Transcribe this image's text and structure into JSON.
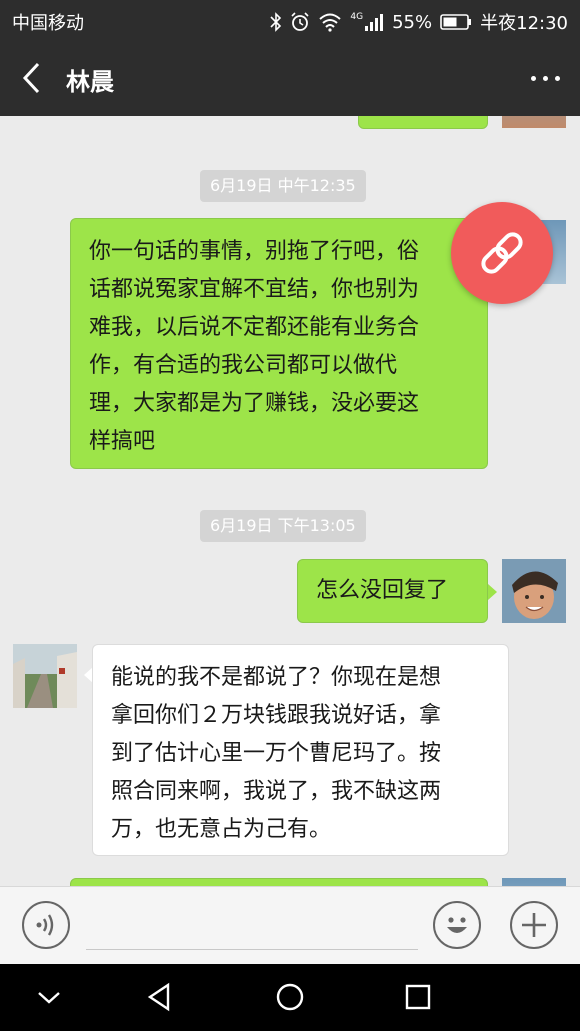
{
  "status_bar": {
    "carrier": "中国移动",
    "network": "4G",
    "battery": "55%",
    "time": "半夜12:30"
  },
  "header": {
    "title": "林晨",
    "back_icon": "back-arrow-icon",
    "more_icon": "more-dots-icon"
  },
  "chat": {
    "timestamp_1": "6月19日 中午12:35",
    "message_1": "你一句话的事情，别拖了行吧，俗话都说冤家宜解不宜结，你也别为难我，以后说不定都还能有业务合作，有合适的我公司都可以做代理，大家都是为了赚钱，没必要这样搞吧",
    "message_1_lines": [
      "你一句话的事情，别拖了行吧，俗",
      "话都说冤家宜解不宜结，你也别为",
      "难我，以后说不定都还能有业务合",
      "作，有合适的我公司都可以做代",
      "理，大家都是为了赚钱，没必要这",
      "样搞吧"
    ],
    "timestamp_2": "6月19日 下午13:05",
    "message_2": "怎么没回复了",
    "message_3_lines": [
      "能说的我不是都说了？你现在是想",
      "拿回你们２万块钱跟我说好话，拿",
      "到了估计心里一万个曹尼玛了。按",
      "照合同来啊，我说了，我不缺这两",
      "万，也无意占为己有。"
    ]
  },
  "input_bar": {
    "voice_icon": "voice-icon",
    "emoji_icon": "emoji-icon",
    "plus_icon": "plus-icon"
  },
  "nav_bar": {
    "icons": [
      "hide-keyboard-icon",
      "back-triangle-icon",
      "home-circle-icon",
      "recents-square-icon"
    ]
  },
  "colors": {
    "header_bg": "#2d2d2d",
    "chat_bg": "#ebebeb",
    "sent_bubble": "#9de449",
    "fab": "#f15b5b"
  }
}
